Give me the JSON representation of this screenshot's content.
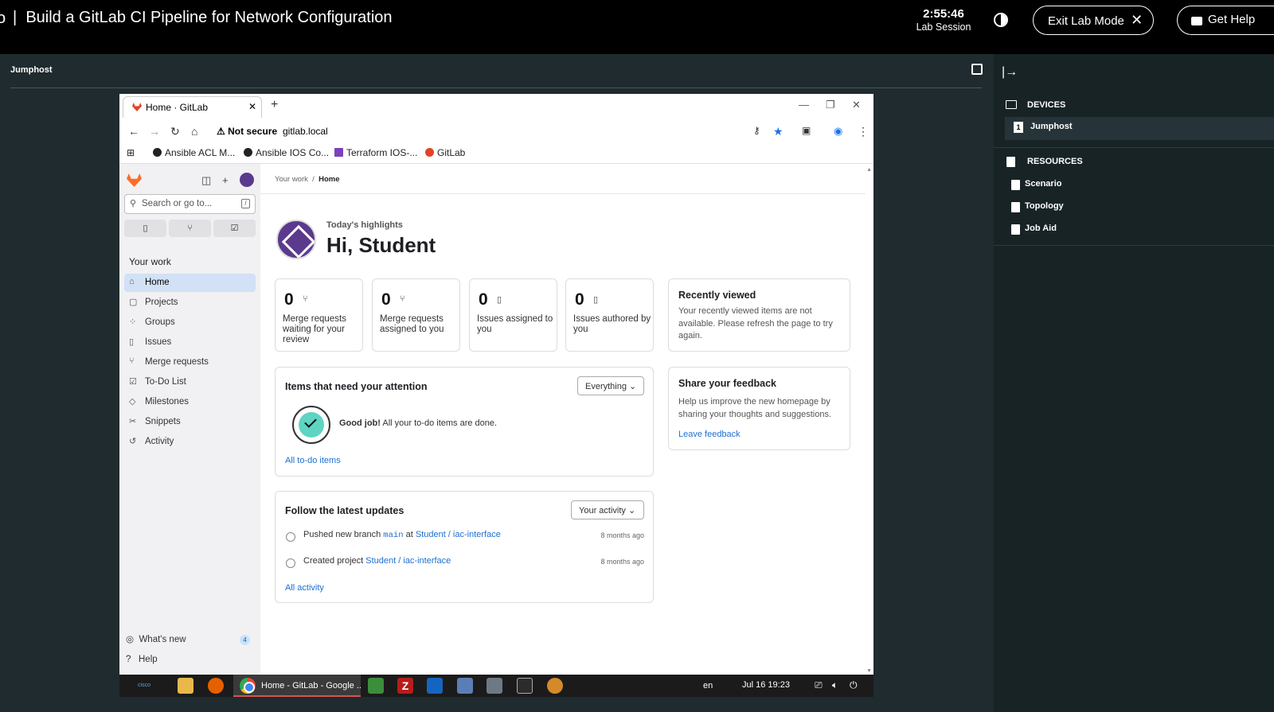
{
  "topbar": {
    "title": "Build a GitLab CI Pipeline for Network Configuration",
    "timer": "2:55:46",
    "timer_label": "Lab Session",
    "exit_label": "Exit Lab Mode",
    "help_label": "Get Help"
  },
  "jumphost_label": "Jumphost",
  "right_panel": {
    "devices_heading": "DEVICES",
    "device_number": "1",
    "device_name": "Jumphost",
    "resources_heading": "RESOURCES",
    "resources": [
      "Scenario",
      "Topology",
      "Job Aid"
    ]
  },
  "browser": {
    "tab_title": "Home · GitLab",
    "not_secure": "Not secure",
    "url": "gitlab.local",
    "bookmarks": [
      "Ansible ACL M...",
      "Ansible IOS Co...",
      "Terraform IOS-...",
      "GitLab"
    ]
  },
  "gitlab": {
    "search_placeholder": "Search or go to...",
    "section_label": "Your work",
    "nav": [
      "Home",
      "Projects",
      "Groups",
      "Issues",
      "Merge requests",
      "To-Do List",
      "Milestones",
      "Snippets",
      "Activity"
    ],
    "whats_new": "What's new",
    "whats_new_count": "4",
    "help": "Help",
    "breadcrumb_parent": "Your work",
    "breadcrumb_current": "Home",
    "highlights_label": "Today's highlights",
    "greeting": "Hi, Student",
    "stats": [
      {
        "value": "0",
        "label": "Merge requests waiting for your review"
      },
      {
        "value": "0",
        "label": "Merge requests assigned to you"
      },
      {
        "value": "0",
        "label": "Issues assigned to you"
      },
      {
        "value": "0",
        "label": "Issues authored by you"
      }
    ],
    "recently_viewed_title": "Recently viewed",
    "recently_viewed_text": "Your recently viewed items are not available. Please refresh the page to try again.",
    "feedback_title": "Share your feedback",
    "feedback_text": "Help us improve the new homepage by sharing your thoughts and suggestions.",
    "feedback_link": "Leave feedback",
    "attention_title": "Items that need your attention",
    "attention_filter": "Everything",
    "goodjob_bold": "Good job!",
    "goodjob_text": "All your to-do items are done.",
    "all_todo_link": "All to-do items",
    "updates_title": "Follow the latest updates",
    "updates_filter": "Your activity",
    "activity": [
      {
        "prefix": "Pushed new branch",
        "code": "main",
        "mid": "at",
        "link": "Student / iac-interface",
        "time": "8 months ago"
      },
      {
        "prefix": "Created project",
        "code": "",
        "mid": "",
        "link": "Student / iac-interface",
        "time": "8 months ago"
      }
    ],
    "all_activity_link": "All activity"
  },
  "taskbar": {
    "chrome_label": "Home - GitLab - Google ...",
    "lang": "en",
    "clock": "Jul 16  19:23"
  }
}
